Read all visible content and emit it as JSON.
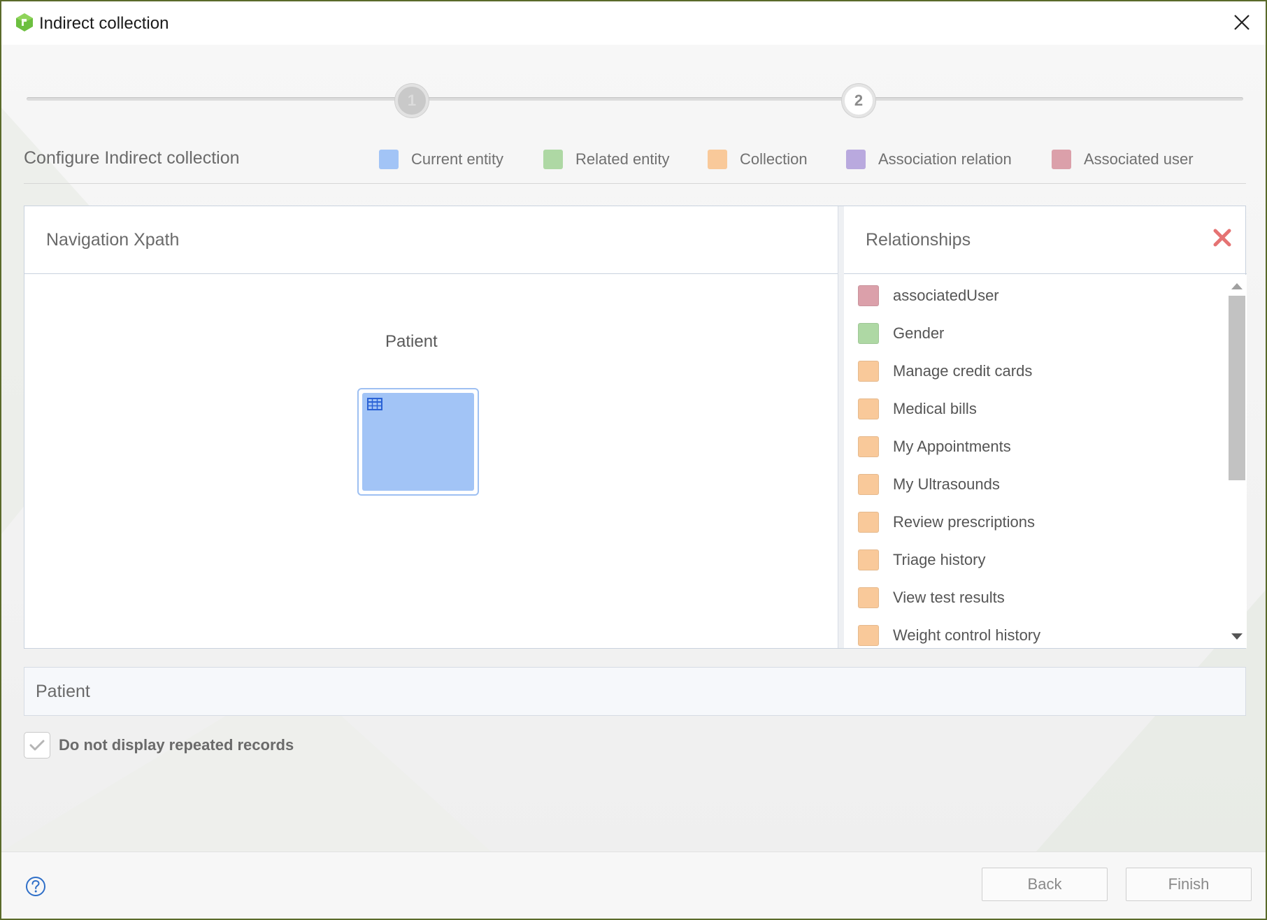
{
  "window": {
    "title": "Indirect collection"
  },
  "stepper": {
    "steps": [
      {
        "label": "1",
        "state": "completed"
      },
      {
        "label": "2",
        "state": "current"
      }
    ]
  },
  "header": {
    "title": "Configure Indirect collection",
    "legend": [
      {
        "label": "Current entity",
        "color": "#a2c4f6"
      },
      {
        "label": "Related entity",
        "color": "#aed8a4"
      },
      {
        "label": "Collection",
        "color": "#f9c99a"
      },
      {
        "label": "Association relation",
        "color": "#b9a9de"
      },
      {
        "label": "Associated user",
        "color": "#dba0aa"
      }
    ]
  },
  "navigation": {
    "title": "Navigation Xpath",
    "entity_name": "Patient",
    "entity_color": "#a2c4f6",
    "entity_icon": "table-icon"
  },
  "relationships": {
    "title": "Relationships",
    "close_icon": "close-icon",
    "items": [
      {
        "label": "associatedUser",
        "color": "#dba0aa"
      },
      {
        "label": "Gender",
        "color": "#aed8a4"
      },
      {
        "label": "Manage credit cards",
        "color": "#f9c99a"
      },
      {
        "label": "Medical bills",
        "color": "#f9c99a"
      },
      {
        "label": "My Appointments",
        "color": "#f9c99a"
      },
      {
        "label": "My Ultrasounds",
        "color": "#f9c99a"
      },
      {
        "label": "Review prescriptions",
        "color": "#f9c99a"
      },
      {
        "label": "Triage history",
        "color": "#f9c99a"
      },
      {
        "label": "View test results",
        "color": "#f9c99a"
      },
      {
        "label": "Weight control history",
        "color": "#f9c99a"
      }
    ]
  },
  "path": {
    "value": "Patient"
  },
  "options": {
    "no_repeated_label": "Do not display repeated records",
    "no_repeated_checked": true
  },
  "footer": {
    "back_label": "Back",
    "finish_label": "Finish",
    "help_icon": "help-icon"
  }
}
